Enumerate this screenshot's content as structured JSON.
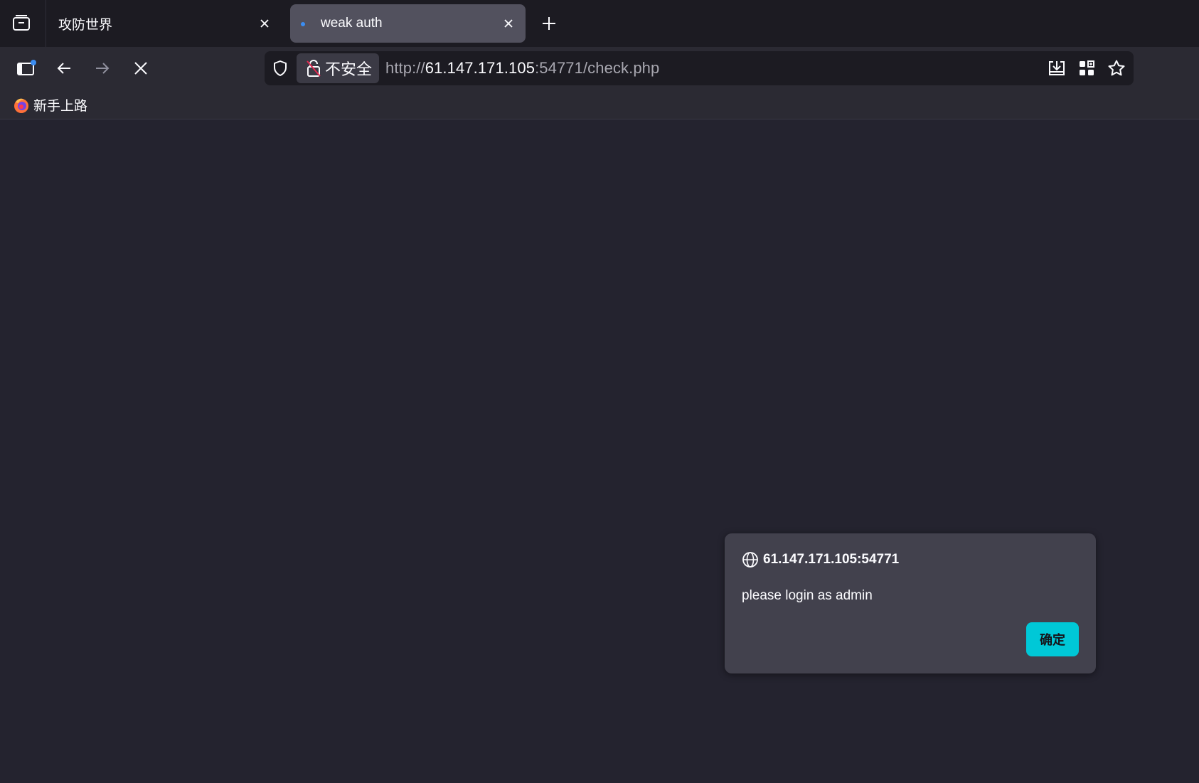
{
  "tabs": [
    {
      "title": "攻防世界",
      "active": false
    },
    {
      "title": "weak auth",
      "active": true,
      "loading_indicator_color": "#3b8df2"
    }
  ],
  "urlbar": {
    "security_label": "不安全",
    "url_prefix": "http://",
    "url_host": "61.147.171.105",
    "url_rest": ":54771/check.php"
  },
  "bookmarks": [
    {
      "label": "新手上路",
      "icon": "firefox-icon"
    }
  ],
  "dialog": {
    "origin": "61.147.171.105:54771",
    "message": "please login as admin",
    "ok_label": "确定"
  },
  "colors": {
    "page_background": "#24232f",
    "accent": "#00c8d7",
    "tabstrip": "#1c1b22",
    "toolbar": "#2b2a33"
  },
  "icons": [
    "tab-manager-icon",
    "close-icon",
    "new-tab-icon",
    "sidebar-icon",
    "back-icon",
    "forward-icon",
    "stop-icon",
    "shield-icon",
    "insecure-lock-icon",
    "save-to-pocket-icon",
    "extensions-grid-icon",
    "bookmark-star-icon",
    "globe-icon"
  ]
}
